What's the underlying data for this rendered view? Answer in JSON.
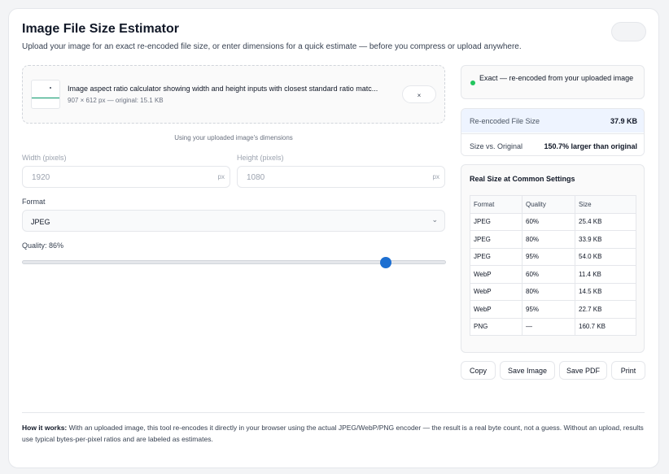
{
  "header": {
    "title": "Image File Size Estimator",
    "subtitle": "Upload your image for an exact re-encoded file size, or enter dimensions for a quick estimate — before you compress or upload anywhere."
  },
  "upload": {
    "file_name": "Image aspect ratio calculator showing width and height inputs with closest standard ratio matc...",
    "file_meta": "907 × 612 px — original: 15.1 KB",
    "remove_label": "×"
  },
  "dims_note": "Using your uploaded image's dimensions",
  "width": {
    "label": "Width (pixels)",
    "value": "1920",
    "unit": "px"
  },
  "height": {
    "label": "Height (pixels)",
    "value": "1080",
    "unit": "px"
  },
  "format": {
    "label": "Format",
    "value": "JPEG",
    "chevron": "⌄"
  },
  "quality": {
    "label": "Quality: 86%",
    "value_percent": 86
  },
  "status": {
    "text": "Exact — re-encoded from your uploaded image",
    "color": "#22c55e"
  },
  "result": {
    "size_label": "Re-encoded File Size",
    "size_value": "37.9 KB",
    "compare_label": "Size vs. Original",
    "compare_value": "150.7% larger than original"
  },
  "common": {
    "title": "Real Size at Common Settings",
    "headers": [
      "Format",
      "Quality",
      "Size"
    ],
    "rows": [
      [
        "JPEG",
        "60%",
        "25.4 KB"
      ],
      [
        "JPEG",
        "80%",
        "33.9 KB"
      ],
      [
        "JPEG",
        "95%",
        "54.0 KB"
      ],
      [
        "WebP",
        "60%",
        "11.4 KB"
      ],
      [
        "WebP",
        "80%",
        "14.5 KB"
      ],
      [
        "WebP",
        "95%",
        "22.7 KB"
      ],
      [
        "PNG",
        "—",
        "160.7 KB"
      ]
    ]
  },
  "actions": {
    "copy": "Copy",
    "save_image": "Save Image",
    "save_pdf": "Save PDF",
    "print": "Print"
  },
  "footer": {
    "lead": "How it works:",
    "text": " With an uploaded image, this tool re-encodes it directly in your browser using the actual JPEG/WebP/PNG encoder — the result is a real byte count, not a guess. Without an upload, results use typical bytes-per-pixel ratios and are labeled as estimates."
  },
  "colors": {
    "accent": "#1d6fd1",
    "success": "#22c55e",
    "highlight_row": "#eef4ff"
  }
}
